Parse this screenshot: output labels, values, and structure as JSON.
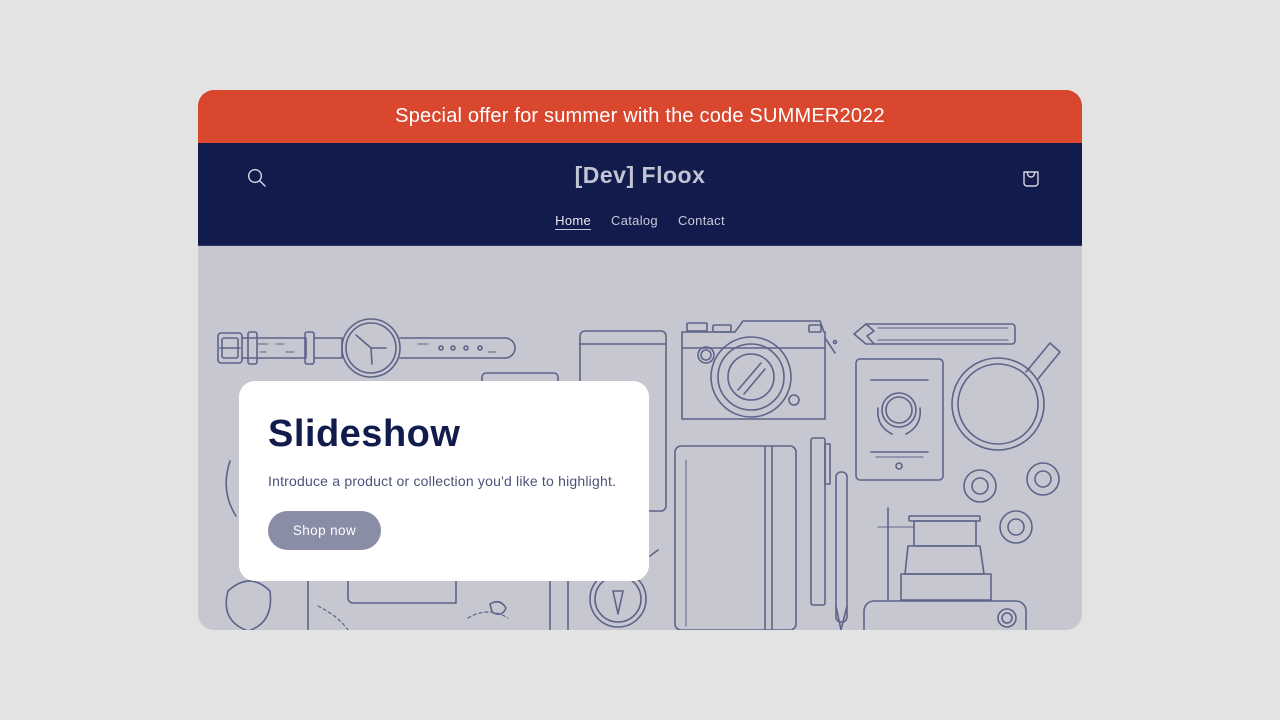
{
  "announcement": {
    "text": "Special offer for summer with the code SUMMER2022"
  },
  "header": {
    "logo": "[Dev] Floox",
    "search_icon": "search-icon",
    "cart_icon": "shopping-bag-icon",
    "nav": [
      {
        "label": "Home",
        "active": true
      },
      {
        "label": "Catalog",
        "active": false
      },
      {
        "label": "Contact",
        "active": false
      }
    ]
  },
  "slideshow": {
    "heading": "Slideshow",
    "text": "Introduce a product or collection you'd like to highlight.",
    "button_label": "Shop now",
    "background_illustration": "flat-lay line drawing of travel items (watch, camera, passport, notebook, pens, coffee cup, compass, map, lens)"
  },
  "colors": {
    "announcement_bg": "#d9472f",
    "header_bg": "#111b4c",
    "hero_bg": "#c6c7d1",
    "heading": "#111b4c",
    "button_bg": "#8a8da6",
    "page_bg": "#e3e3e3"
  }
}
